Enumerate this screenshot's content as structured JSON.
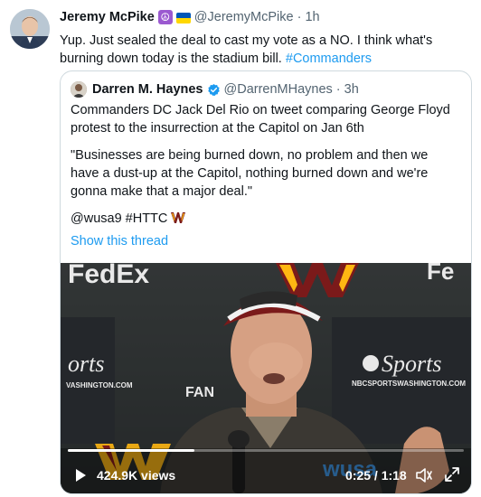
{
  "tweet": {
    "author_name": "Jeremy McPike",
    "author_emoji_1": "☮",
    "handle": "@JeremyMcPike",
    "separator": "·",
    "time": "1h",
    "text": "Yup. Just sealed the deal to cast my vote as a NO. I think what's burning down today is the stadium bill.",
    "hashtag": "#Commanders"
  },
  "quoted": {
    "author_name": "Darren M. Haynes",
    "handle": "@DarrenMHaynes",
    "separator": "·",
    "time": "3h",
    "paragraph_1": "Commanders DC Jack Del Rio on tweet comparing George Floyd protest to the insurrection at the Capitol on Jan 6th",
    "paragraph_2": "\"Businesses are being burned down, no problem and then we have a dust-up at the Capitol, nothing burned down and we're gonna make that a major deal.\"",
    "paragraph_3": "@wusa9 #HTTC",
    "show_thread": "Show this thread"
  },
  "video": {
    "views": "424.9K views",
    "time": "0:25 / 1:18",
    "progress": 0.32
  },
  "colors": {
    "link": "#1d9bf0",
    "text": "#0f1419",
    "muted": "#536471",
    "verified": "#1d9bf0",
    "commanders_burgundy": "#5a1414",
    "commanders_gold": "#ffb612"
  },
  "icons": {
    "avatar": "avatar",
    "peace": "peace-emoji-icon",
    "flag": "ukraine-flag-icon",
    "verified": "verified-badge-icon",
    "play": "play-icon",
    "volume": "volume-icon",
    "fullscreen": "fullscreen-icon"
  }
}
